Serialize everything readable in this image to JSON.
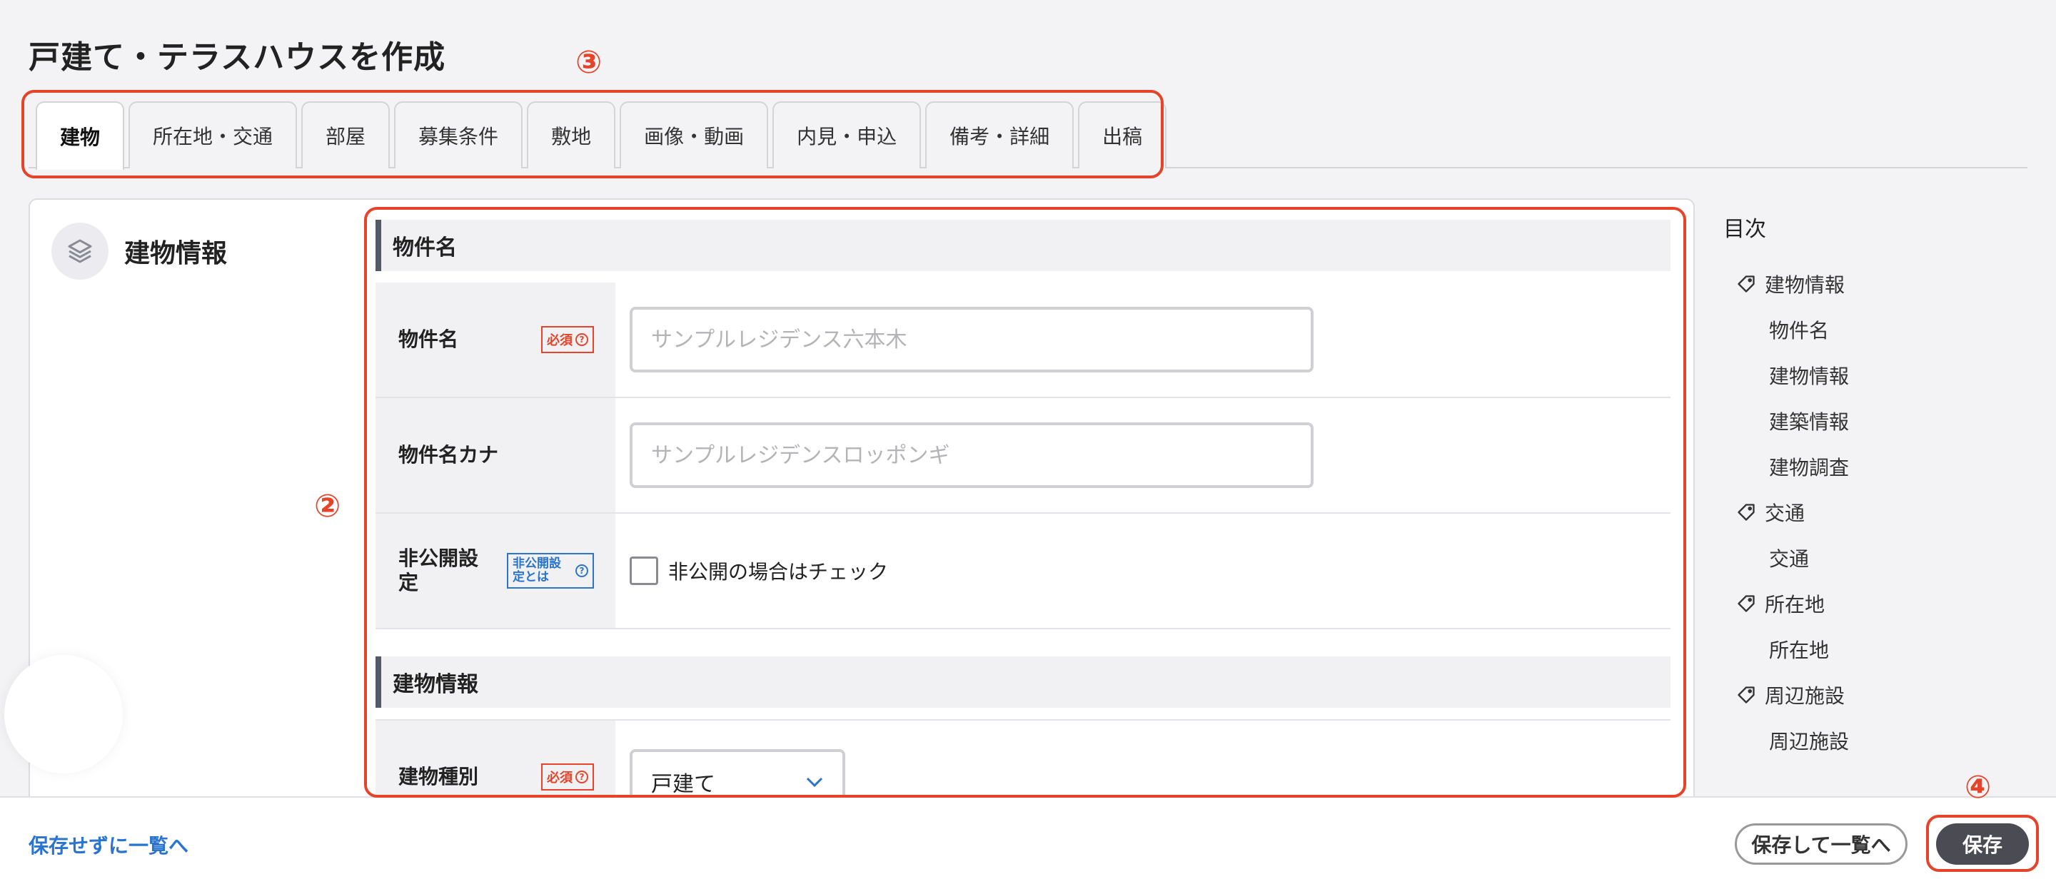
{
  "page": {
    "title": "戸建て・テラスハウスを作成"
  },
  "annotations": {
    "tabs_marker": "③",
    "form_marker": "②",
    "save_marker": "④"
  },
  "tabs": [
    {
      "label": "建物",
      "active": true
    },
    {
      "label": "所在地・交通"
    },
    {
      "label": "部屋"
    },
    {
      "label": "募集条件"
    },
    {
      "label": "敷地"
    },
    {
      "label": "画像・動画"
    },
    {
      "label": "内見・申込"
    },
    {
      "label": "備考・詳細"
    },
    {
      "label": "出稿"
    }
  ],
  "section": {
    "title": "建物情報",
    "icon": "layers-icon"
  },
  "form": {
    "group1": {
      "title": "物件名"
    },
    "property_name": {
      "label": "物件名",
      "badge": "必須",
      "placeholder": "サンプルレジデンス六本木",
      "value": ""
    },
    "property_name_kana": {
      "label": "物件名カナ",
      "placeholder": "サンプルレジデンスロッポンギ",
      "value": ""
    },
    "private": {
      "label": "非公開設定",
      "badge": "非公開設定とは",
      "checkbox_label": "非公開の場合はチェック",
      "checked": false
    },
    "group2": {
      "title": "建物情報"
    },
    "building_type": {
      "label": "建物種別",
      "badge": "必須",
      "value": "戸建て"
    }
  },
  "toc": {
    "title": "目次",
    "items": [
      {
        "label": "建物情報",
        "level": 1
      },
      {
        "label": "物件名",
        "level": 2
      },
      {
        "label": "建物情報",
        "level": 2
      },
      {
        "label": "建築情報",
        "level": 2
      },
      {
        "label": "建物調査",
        "level": 2
      },
      {
        "label": "交通",
        "level": 1
      },
      {
        "label": "交通",
        "level": 2
      },
      {
        "label": "所在地",
        "level": 1
      },
      {
        "label": "所在地",
        "level": 2
      },
      {
        "label": "周辺施設",
        "level": 1
      },
      {
        "label": "周辺施設",
        "level": 2
      }
    ]
  },
  "footer": {
    "back_link": "保存せずに一覧へ",
    "save_and_list": "保存して一覧へ",
    "save": "保存"
  },
  "colors": {
    "accent_red": "#e5442a",
    "link_blue": "#2a74d0",
    "primary_button": "#4b4b54"
  }
}
